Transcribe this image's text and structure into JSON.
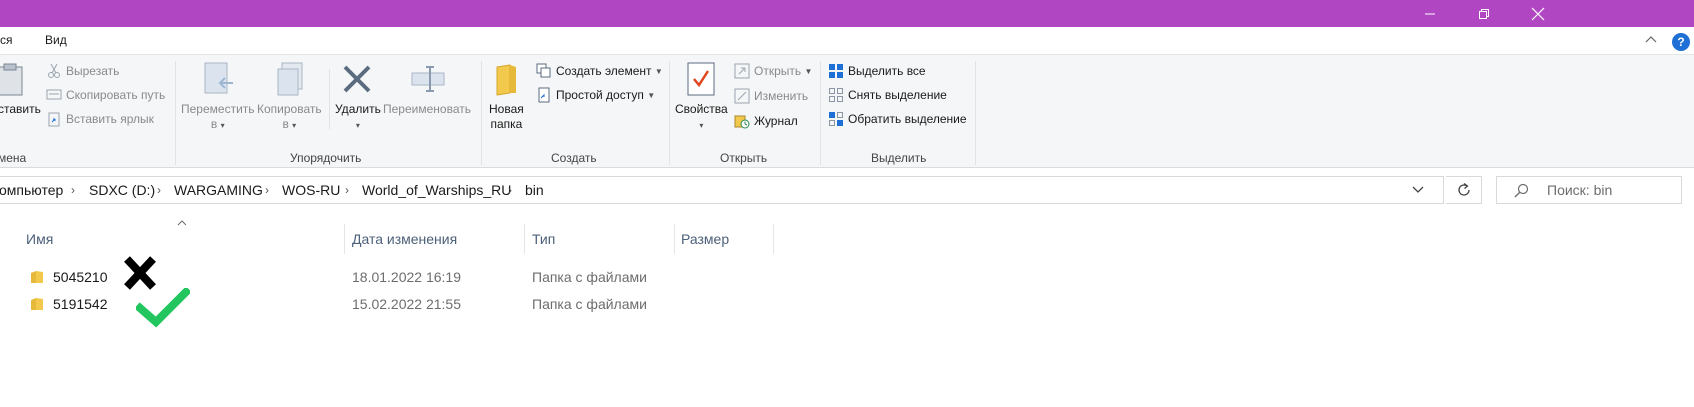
{
  "window": {
    "title_color": "#b146c2",
    "controls": [
      "minimize-icon",
      "maximize-icon",
      "close-icon"
    ]
  },
  "menu": {
    "tab_partial": "ся",
    "tab_view": "Вид"
  },
  "ribbon": {
    "clipboard": {
      "paste_label": "ставить",
      "cut": "Вырезать",
      "copy_path": "Скопировать путь",
      "paste_shortcut": "Вставить ярлык",
      "group_label": "мена"
    },
    "organize": {
      "move_to_1": "Переместить",
      "move_to_2": "в",
      "copy_to_1": "Копировать",
      "copy_to_2": "в",
      "delete": "Удалить",
      "rename": "Переименовать",
      "group_label": "Упорядочить"
    },
    "new": {
      "new_folder_1": "Новая",
      "new_folder_2": "папка",
      "new_item": "Создать элемент",
      "easy_access": "Простой доступ",
      "group_label": "Создать"
    },
    "open": {
      "properties": "Свойства",
      "open": "Открыть",
      "edit": "Изменить",
      "history": "Журнал",
      "group_label": "Открыть"
    },
    "select": {
      "select_all": "Выделить все",
      "select_none": "Снять выделение",
      "invert": "Обратить выделение",
      "group_label": "Выделить"
    }
  },
  "address": {
    "crumbs": [
      "омпьютер",
      "SDXC (D:)",
      "WARGAMING",
      "WOS-RU",
      "World_of_Warships_RU",
      "bin"
    ],
    "search_placeholder": "Поиск: bin"
  },
  "columns": {
    "name": "Имя",
    "date": "Дата изменения",
    "type": "Тип",
    "size": "Размер"
  },
  "files": [
    {
      "name": "5045210",
      "date": "18.01.2022 16:19",
      "type": "Папка с файлами",
      "mark": "cross-mark-icon"
    },
    {
      "name": "5191542",
      "date": "15.02.2022 21:55",
      "type": "Папка с файлами",
      "mark": "check-mark-icon"
    }
  ],
  "colors": {
    "accent_blue": "#1e6fd6",
    "folder_yellow": "#f2c94c",
    "check_green": "#22c55e",
    "cross_black": "#000000"
  }
}
